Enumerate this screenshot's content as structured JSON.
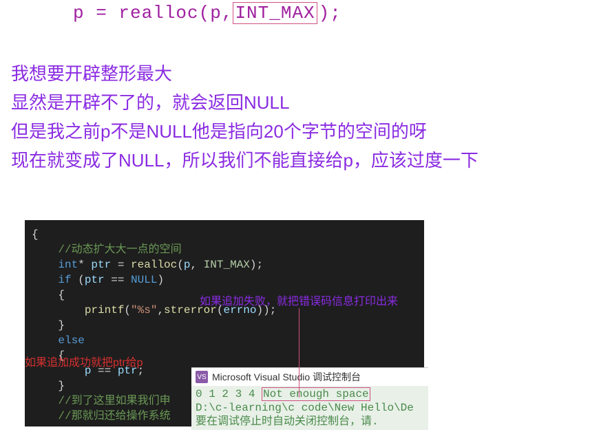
{
  "top_code": {
    "prefix": "p = realloc(p,",
    "boxed": "INT_MAX",
    "suffix": ");"
  },
  "explanation": {
    "l1": "我想要开辟整形最大",
    "l2": "显然是开辟不了的，就会返回NULL",
    "l3": "但是我之前p不是NULL他是指向20个字节的空间的呀",
    "l4": "现在就变成了NULL，所以我们不能直接给p，应该过度一下"
  },
  "editor": {
    "cmt1": "//动态扩大大一点的空间",
    "decl_kw": "int",
    "decl_ptr": "* ",
    "decl_name": "ptr",
    "decl_eq": " = ",
    "decl_fn": "realloc",
    "decl_args_open": "(",
    "decl_p": "p",
    "decl_comma": ", ",
    "decl_max": "INT_MAX",
    "decl_close": ");",
    "if_kw": "if ",
    "if_open": "(",
    "if_ptr": "ptr",
    "if_eqeq": " == ",
    "if_null": "NULL",
    "if_close": ")",
    "lbrace": "{",
    "printf": "printf",
    "printf_open": "(",
    "printf_str": "\"%s\"",
    "printf_comma": ",",
    "strerror": "strerror",
    "strerror_open": "(",
    "errno": "errno",
    "strerror_close": ")",
    "printf_close": ");",
    "rbrace": "}",
    "else": "else",
    "assign_p": "p",
    "assign_eq": " == ",
    "assign_ptr": "ptr",
    "assign_semi": ";",
    "cmt2": "//到了这里如果我们申",
    "cmt3": "//那就归还给操作系统"
  },
  "annotations": {
    "red": "如果追加成功就把ptr给p",
    "purple": "如果追加失败，就把错误码信息打印出来"
  },
  "console": {
    "title": "Microsoft Visual Studio 调试控制台",
    "vs_icon_label": "VS",
    "nums": "0 1 2 3 4 ",
    "notenough": "Not enough space",
    "path": "D:\\c-learning\\c code\\New Hello\\De",
    "hint": "要在调试停止时自动关闭控制台，请."
  }
}
